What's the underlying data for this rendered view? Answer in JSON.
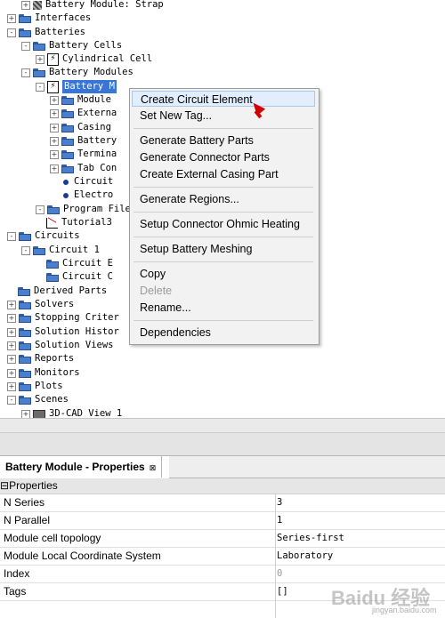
{
  "tree": {
    "items": [
      {
        "label": "Battery Module: Strap",
        "icon": "strap-icon",
        "expander": "+"
      },
      {
        "label": "Interfaces",
        "icon": "folder-icon",
        "expander": "+"
      },
      {
        "label": "Batteries",
        "icon": "folder-icon",
        "expander": "-"
      },
      {
        "label": "Battery Cells",
        "icon": "folder-icon",
        "expander": "-"
      },
      {
        "label": "Cylindrical Cell",
        "icon": "cell-icon",
        "expander": "+"
      },
      {
        "label": "Battery Modules",
        "icon": "folder-icon",
        "expander": "-"
      },
      {
        "label": "Battery M",
        "icon": "cell-icon",
        "expander": "-",
        "selected": true
      },
      {
        "label": "Module",
        "icon": "folder-icon",
        "expander": "+"
      },
      {
        "label": "Externa",
        "icon": "folder-icon",
        "expander": "+"
      },
      {
        "label": "Casing",
        "icon": "folder-icon",
        "expander": "+"
      },
      {
        "label": "Battery",
        "icon": "folder-icon",
        "expander": "+"
      },
      {
        "label": "Termina",
        "icon": "folder-icon",
        "expander": "+"
      },
      {
        "label": "Tab Con",
        "icon": "folder-icon",
        "expander": "+"
      },
      {
        "label": "Circuit",
        "icon": "dot-icon",
        "expander": ""
      },
      {
        "label": "Electro",
        "icon": "dot-icon",
        "expander": ""
      },
      {
        "label": "Program File",
        "icon": "folder-icon",
        "expander": "-"
      },
      {
        "label": "Tutorial3",
        "icon": "graph-icon",
        "expander": ""
      },
      {
        "label": "Circuits",
        "icon": "folder-icon",
        "expander": "-"
      },
      {
        "label": "Circuit 1",
        "icon": "folder-icon",
        "expander": "-"
      },
      {
        "label": "Circuit E",
        "icon": "folder-icon",
        "expander": ""
      },
      {
        "label": "Circuit C",
        "icon": "folder-icon",
        "expander": ""
      },
      {
        "label": "Derived Parts",
        "icon": "folder-icon",
        "expander": ""
      },
      {
        "label": "Solvers",
        "icon": "folder-icon",
        "expander": "+"
      },
      {
        "label": "Stopping Criter",
        "icon": "folder-icon",
        "expander": "+"
      },
      {
        "label": "Solution Histor",
        "icon": "folder-icon",
        "expander": "+"
      },
      {
        "label": "Solution Views",
        "icon": "folder-icon",
        "expander": "+"
      },
      {
        "label": "Reports",
        "icon": "folder-icon",
        "expander": "+"
      },
      {
        "label": "Monitors",
        "icon": "folder-icon",
        "expander": "+"
      },
      {
        "label": "Plots",
        "icon": "folder-icon",
        "expander": "+"
      },
      {
        "label": "Scenes",
        "icon": "folder-icon",
        "expander": "-"
      },
      {
        "label": "3D-CAD View 1",
        "icon": "cad-icon",
        "expander": "+"
      }
    ]
  },
  "context_menu": {
    "items": [
      {
        "label": "Create Circuit Element",
        "highlighted": true
      },
      {
        "label": "Set New Tag..."
      },
      {
        "separator": true
      },
      {
        "label": "Generate Battery Parts"
      },
      {
        "label": "Generate Connector Parts"
      },
      {
        "label": "Create External Casing Part"
      },
      {
        "separator": true
      },
      {
        "label": "Generate Regions..."
      },
      {
        "separator": true
      },
      {
        "label": "Setup Connector Ohmic Heating"
      },
      {
        "separator": true
      },
      {
        "label": "Setup Battery Meshing"
      },
      {
        "separator": true
      },
      {
        "label": "Copy"
      },
      {
        "label": "Delete",
        "disabled": true
      },
      {
        "label": "Rename..."
      },
      {
        "separator": true
      },
      {
        "label": "Dependencies"
      }
    ]
  },
  "properties": {
    "tab_title": "Battery Module - Properties",
    "tab_close": "⊠",
    "section": "Properties",
    "section_toggle": "⊟",
    "rows": [
      {
        "name": "N Series",
        "value": "3"
      },
      {
        "name": "N Parallel",
        "value": "1"
      },
      {
        "name": "Module cell topology",
        "value": "Series-first"
      },
      {
        "name": "Module Local Coordinate System",
        "value": "Laboratory"
      },
      {
        "name": "Index",
        "value": "0",
        "dim": true
      },
      {
        "name": "Tags",
        "value": "[]"
      }
    ]
  },
  "watermark": {
    "text": "Baidu 经验",
    "sub": "jingyan.baidu.com"
  }
}
